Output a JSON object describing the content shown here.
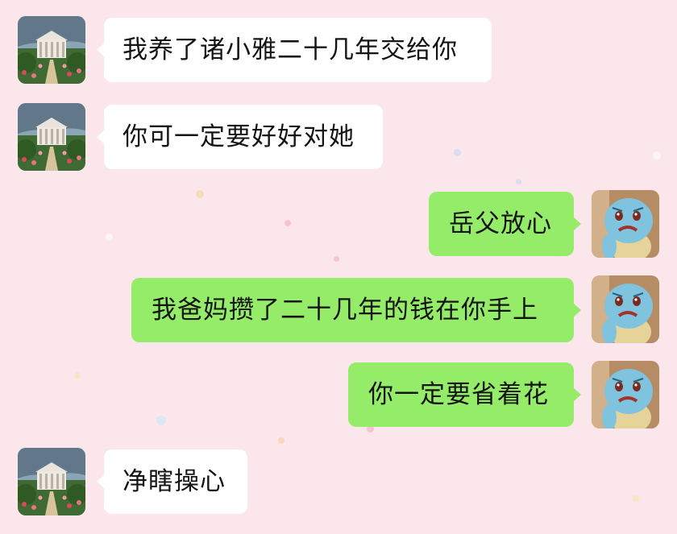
{
  "chat": {
    "messages": [
      {
        "side": "left",
        "avatar": "temple-garden-avatar",
        "text": "我养了诸小雅二十几年交给你"
      },
      {
        "side": "left",
        "avatar": "temple-garden-avatar",
        "text": "你可一定要好好对她"
      },
      {
        "side": "right",
        "avatar": "squirtle-avatar",
        "text": "岳父放心"
      },
      {
        "side": "right",
        "avatar": "squirtle-avatar",
        "text": "我爸妈攒了二十几年的钱在你手上"
      },
      {
        "side": "right",
        "avatar": "squirtle-avatar",
        "text": "你一定要省着花"
      },
      {
        "side": "left",
        "avatar": "temple-garden-avatar",
        "text": "净瞎操心"
      }
    ]
  },
  "colors": {
    "background": "#fbe6ec",
    "incoming_bubble": "#ffffff",
    "outgoing_bubble": "#95ec69",
    "text": "#141414"
  }
}
